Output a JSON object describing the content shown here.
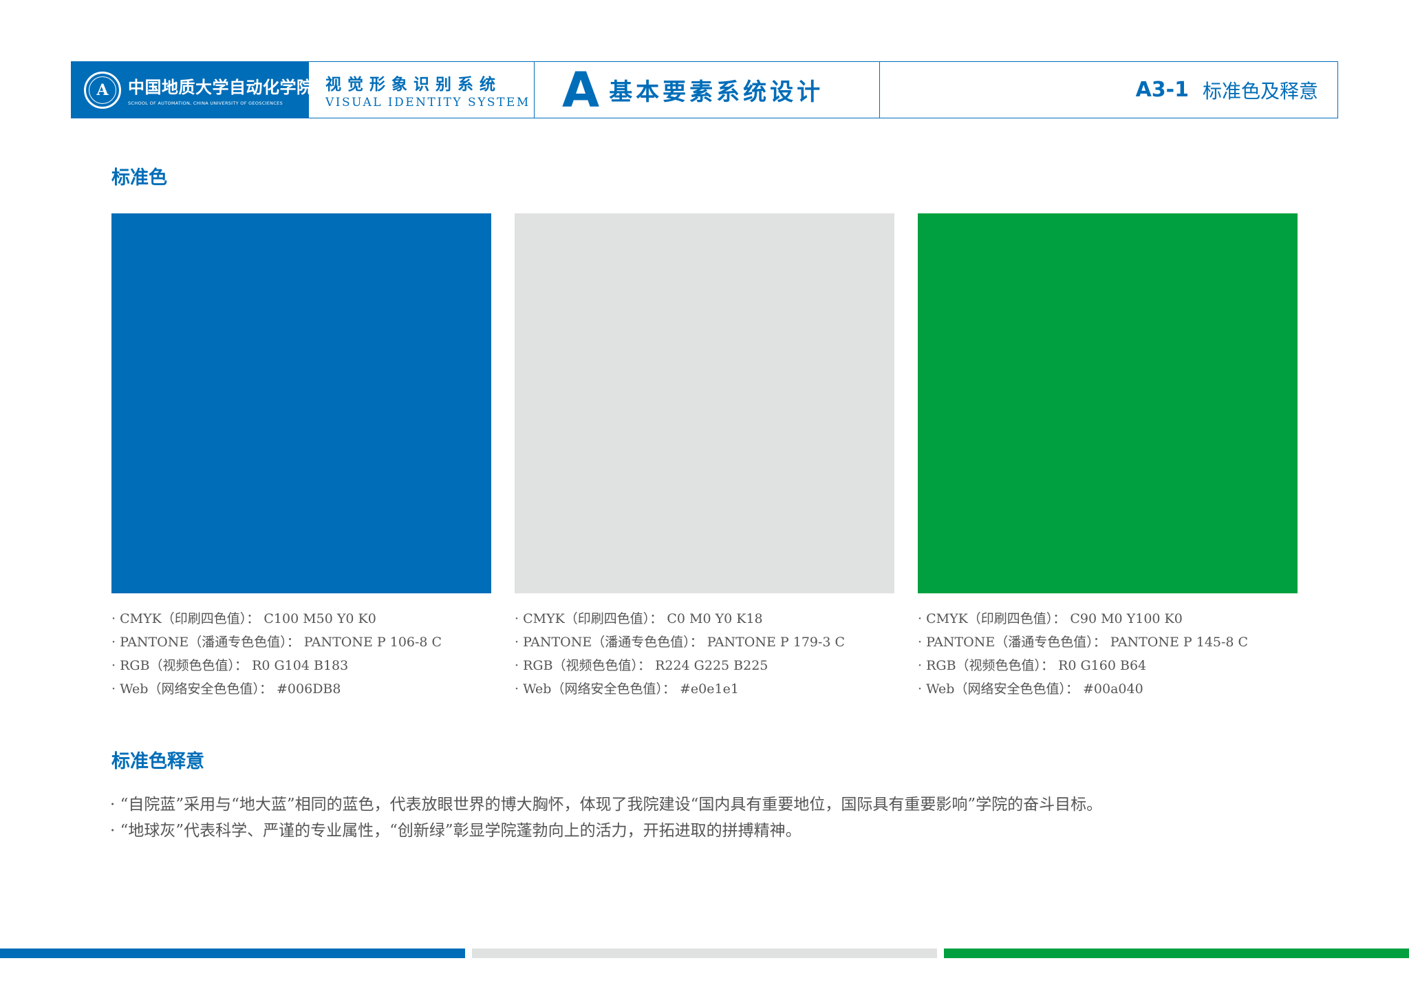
{
  "header": {
    "school_cn": "中国地质大学自动化学院",
    "school_en": "SCHOOL OF AUTOMATION, CHINA UNIVERSITY OF GEOSCIENCES",
    "vis_cn": "视觉形象识别系统",
    "vis_en": "VISUAL IDENTITY SYSTEM",
    "section_letter": "A",
    "section_title": "基本要素系统设计",
    "page_code": "A3-1",
    "page_name": "标准色及释意"
  },
  "standard_colors": {
    "title": "标准色",
    "swatches": [
      {
        "color": "#006DB8",
        "cmyk": "· CMYK（印刷四色值）： C100 M50 Y0 K0",
        "pantone": "· PANTONE（潘通专色色值）： PANTONE P 106-8 C",
        "rgb": "· RGB（视频色色值）： R0 G104 B183",
        "web": "· Web（网络安全色色值）： #006DB8"
      },
      {
        "color": "#e0e1e1",
        "cmyk": "· CMYK（印刷四色值）： C0 M0 Y0 K18",
        "pantone": "· PANTONE（潘通专色色值）： PANTONE P 179-3 C",
        "rgb": "· RGB（视频色色值）： R224 G225 B225",
        "web": "· Web（网络安全色色值）： #e0e1e1"
      },
      {
        "color": "#00a040",
        "cmyk": "· CMYK（印刷四色值）： C90 M0 Y100 K0",
        "pantone": "· PANTONE（潘通专色色值）： PANTONE P 145-8 C",
        "rgb": "· RGB（视频色色值）： R0 G160 B64",
        "web": "· Web（网络安全色色值）： #00a040"
      }
    ]
  },
  "meaning": {
    "title": "标准色释意",
    "lines": [
      "· “自院蓝”采用与“地大蓝”相同的蓝色，代表放眼世界的博大胸怀，体现了我院建设“国内具有重要地位，国际具有重要影响”学院的奋斗目标。",
      "· “地球灰”代表科学、严谨的专业属性，“创新绿”彰显学院蓬勃向上的活力，开拓进取的拼搏精神。"
    ]
  },
  "footer_bar_colors": [
    "#006DB8",
    "#e0e1e1",
    "#00a040"
  ]
}
